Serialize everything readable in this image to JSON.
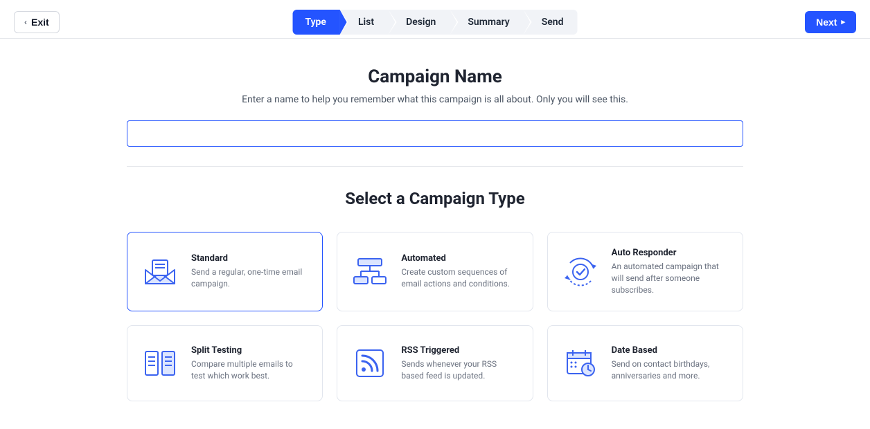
{
  "topbar": {
    "exit_label": "Exit",
    "next_label": "Next"
  },
  "stepper": {
    "items": [
      {
        "label": "Type",
        "active": true
      },
      {
        "label": "List",
        "active": false
      },
      {
        "label": "Design",
        "active": false
      },
      {
        "label": "Summary",
        "active": false
      },
      {
        "label": "Send",
        "active": false
      }
    ]
  },
  "campaign_name": {
    "heading": "Campaign Name",
    "subheading": "Enter a name to help you remember what this campaign is all about. Only you will see this.",
    "value": ""
  },
  "type_section": {
    "heading": "Select a Campaign Type",
    "cards": [
      {
        "title": "Standard",
        "desc": "Send a regular, one-time email campaign.",
        "selected": true
      },
      {
        "title": "Automated",
        "desc": "Create custom sequences of email actions and conditions.",
        "selected": false
      },
      {
        "title": "Auto Responder",
        "desc": "An automated campaign that will send after someone subscribes.",
        "selected": false
      },
      {
        "title": "Split Testing",
        "desc": "Compare multiple emails to test which work best.",
        "selected": false
      },
      {
        "title": "RSS Triggered",
        "desc": "Sends whenever your RSS based feed is updated.",
        "selected": false
      },
      {
        "title": "Date Based",
        "desc": "Send on contact birthdays, anniversaries and more.",
        "selected": false
      }
    ]
  },
  "colors": {
    "accent": "#2454ff",
    "icon_stroke": "#3b63f0",
    "icon_fill": "#dce5ff"
  }
}
